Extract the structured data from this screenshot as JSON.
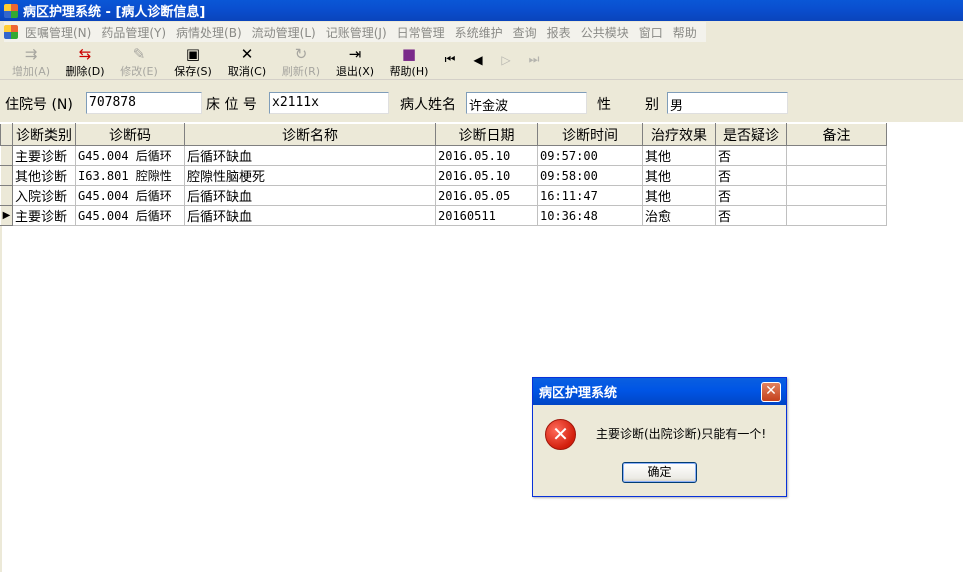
{
  "window": {
    "title": "病区护理系统  - [病人诊断信息]"
  },
  "menu": [
    "医嘱管理(N)",
    "药品管理(Y)",
    "病情处理(B)",
    "流动管理(L)",
    "记账管理(J)",
    "日常管理",
    "系统维护",
    "查询",
    "报表",
    "公共模块",
    "窗口",
    "帮助"
  ],
  "toolbar": {
    "add": "增加(A)",
    "delete": "删除(D)",
    "edit": "修改(E)",
    "save": "保存(S)",
    "cancel": "取消(C)",
    "refresh": "刷新(R)",
    "exit": "退出(X)",
    "help": "帮助(H)"
  },
  "patient": {
    "admission_label": "住院号 (N)",
    "admission_value": "707878",
    "bed_label": "床 位 号",
    "bed_value": "x2111x",
    "name_label": "病人姓名",
    "name_value": "许金波",
    "sex_label1": "性",
    "sex_label2": "别",
    "sex_value": "男"
  },
  "grid": {
    "headers": [
      "诊断类别",
      "诊断码",
      "诊断名称",
      "诊断日期",
      "诊断时间",
      "治疗效果",
      "是否疑诊",
      "备注"
    ],
    "rows": [
      {
        "indicator": "",
        "type": "主要诊断",
        "code": "G45.004 后循环",
        "name": "后循环缺血",
        "date": "2016.05.10",
        "time": "09:57:00",
        "effect": "其他",
        "suspect": "否",
        "remark": ""
      },
      {
        "indicator": "",
        "type": "其他诊断",
        "code": "I63.801 腔隙性",
        "name": "腔隙性脑梗死",
        "date": "2016.05.10",
        "time": "09:58:00",
        "effect": "其他",
        "suspect": "否",
        "remark": ""
      },
      {
        "indicator": "",
        "type": "入院诊断",
        "code": "G45.004 后循环",
        "name": "后循环缺血",
        "date": "2016.05.05",
        "time": "16:11:47",
        "effect": "其他",
        "suspect": "否",
        "remark": ""
      },
      {
        "indicator": "▶",
        "type": "主要诊断",
        "code": "G45.004 后循环",
        "name": "后循环缺血",
        "date": "20160511",
        "time": "10:36:48",
        "effect": "治愈",
        "suspect": "否",
        "remark": ""
      }
    ]
  },
  "dialog": {
    "title": "病区护理系统",
    "message": "主要诊断(出院诊断)只能有一个!",
    "ok": "确定"
  }
}
